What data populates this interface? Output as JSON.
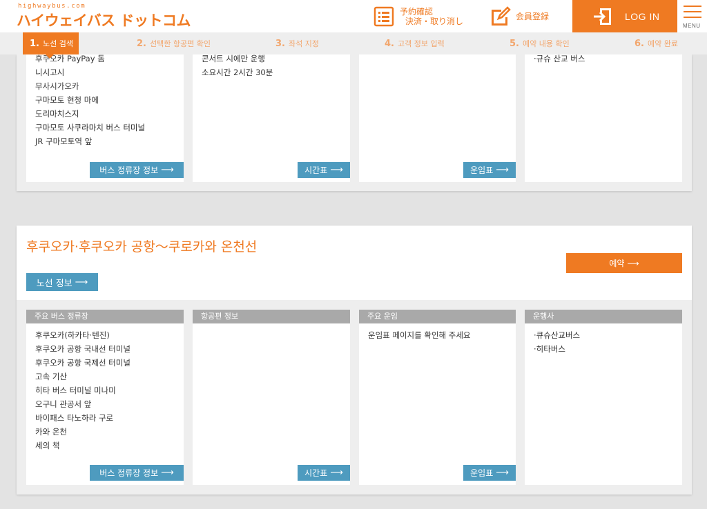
{
  "header": {
    "logo_sub": "highwaybus.com",
    "logo_main": "ハイウェイバス ドットコム",
    "reservation_line1": "予約確認",
    "reservation_line2": "決済・取り消し",
    "member_label": "会員登録",
    "login_label": "LOG IN",
    "menu_label": "MENU"
  },
  "steps": [
    {
      "num": "1.",
      "label": "노선 검색",
      "active": true
    },
    {
      "num": "2.",
      "label": "선택한 항공편 확인"
    },
    {
      "num": "3.",
      "label": "좌석 지정"
    },
    {
      "num": "4.",
      "label": "고객 정보 입력"
    },
    {
      "num": "5.",
      "label": "예약 내용 확인"
    },
    {
      "num": "6.",
      "label": "예약 완료"
    }
  ],
  "top_card": {
    "stops": [
      "후쿠오카 PayPay 돔",
      "니시고시",
      "무사시가오카",
      "구마모토 현청 마에",
      "도리마치스지",
      "구마모토 사쿠라마치 버스 터미널",
      "JR 구마모토역 앞"
    ],
    "flight_info": [
      "콘서트 시에만 운행",
      "소요시간 2시간 30분"
    ],
    "operators": [
      "·규슈 산교 버스"
    ],
    "stop_btn": "버스 정류장 정보",
    "timetable_btn": "시간표",
    "fare_btn": "운임표"
  },
  "route_card": {
    "title": "후쿠오카·후쿠오카 공항～쿠로카와 온천선",
    "reserve_btn": "예약",
    "route_info_btn": "노선 정보",
    "col_stops_header": "주요 버스 정류장",
    "col_flight_header": "항공편 정보",
    "col_fare_header": "주요 운임",
    "col_operator_header": "운행사",
    "stops": [
      "후쿠오카(하카타·텐진)",
      "후쿠오카 공항 국내선 터미널",
      "후쿠오카 공항 국제선 터미널",
      "고속 기산",
      "히타 버스 터미널 미나미",
      "오구니 관공서 앞",
      "바이패스 타노하라 구로",
      "카와 온천",
      "세의 책"
    ],
    "fare_text": "운임표 페이지를 확인해 주세요",
    "operators": [
      "·큐슈산교버스",
      "·히타버스"
    ],
    "stop_btn": "버스 정류장 정보",
    "timetable_btn": "시간표",
    "fare_btn": "운임표"
  },
  "arrow": "⟶",
  "colors": {
    "accent": "#ef7a22",
    "button_blue": "#4e9bbf",
    "column_header": "#a9a9a9"
  }
}
